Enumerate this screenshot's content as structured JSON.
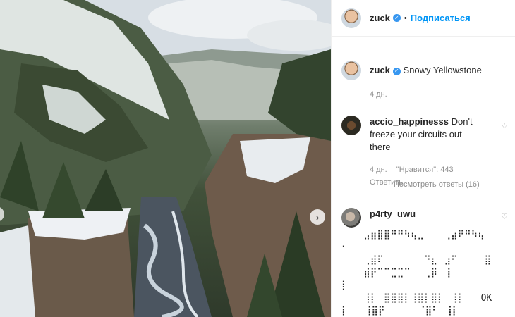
{
  "post": {
    "author": "zuck",
    "follow_label": "Подписаться",
    "dot": "•",
    "caption": {
      "username": "zuck",
      "text": "Snowy Yellowstone",
      "time": "4 дн."
    }
  },
  "comments": [
    {
      "username": "accio_happinesss",
      "text": "Don't freeze your circuits out there",
      "time": "4 дн.",
      "likes": "\"Нравится\": 443",
      "reply_label": "Ответить",
      "view_replies": "Посмотреть ответы (16)"
    },
    {
      "username": "p4rty_uwu",
      "art": "    ⣠⣶⣿⣿⠛⠛⠳⢦⣀⠀⠀⠀⢀⣴⠟⠛⠳⢦\n⠂\n    ⢀⣾⠏⠀⠀⠀⠀⠀⠀⠙⣆⠀⣰⠋⠀⠀⠀⠀⣿\n    ⣾⡟⠉⠉⣉⣉⠉⠀⠀⢀⡿⠀⢸⠀⠀\n⡇\n    ⢸⡇⠀⣿⣿⣿⡇⢸⣿⡇⣿⡇⠀⢸⡇   OK\n⡇   ⢸⣿⡟⠀⠀⠀⠀⠀⠈⣿⠃⠀⢸⡇"
    }
  ],
  "icons": {
    "heart": "♡",
    "next": "›",
    "verified": "✓"
  }
}
